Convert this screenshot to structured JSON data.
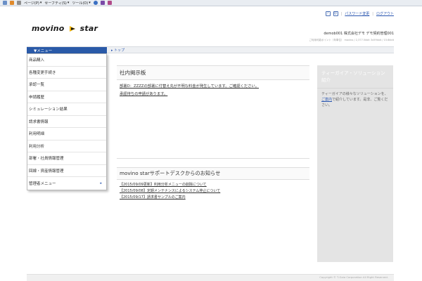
{
  "browser": {
    "toolbar": [
      "ページ(P)",
      "セーフティ(S)",
      "ツール(O)"
    ]
  },
  "header": {
    "help_icon": "?",
    "password_change": "パスワード変更",
    "logout": "ログアウト",
    "logo_left": "movino",
    "logo_right": "star",
    "user_line": "demob001  株式会社デモ  デモ契約管理001",
    "sub_line": "ご利用可能ポイント（年単位） movino / 2,377.5kbit   3x59kbit / 15.6kbit"
  },
  "nav": {
    "menu_label": "▼メニュー",
    "breadcrumb": "▸ トップ"
  },
  "menu": {
    "items": [
      {
        "label": "商品購入",
        "has_sub": false
      },
      {
        "label": "各種変更手続き",
        "has_sub": false
      },
      {
        "label": "承認一覧",
        "has_sub": false
      },
      {
        "label": "申請履歴",
        "has_sub": false
      },
      {
        "label": "シミュレーション結果",
        "has_sub": false
      },
      {
        "label": "請求書情報",
        "has_sub": false
      },
      {
        "label": "利用明細",
        "has_sub": false
      },
      {
        "label": "利用分析",
        "has_sub": false
      },
      {
        "label": "部署・社員情報管理",
        "has_sub": false
      },
      {
        "label": "回線・資産情報管理",
        "has_sub": false
      },
      {
        "label": "管理者メニュー",
        "has_sub": true,
        "arrow": "▸"
      }
    ]
  },
  "bbs": {
    "title": "社内掲示板",
    "lines": [
      "部署D：ZZZZの部署に付替え先が不明な料金が発生しています。ご確認ください。",
      "承認待ちの申請があります。"
    ]
  },
  "support": {
    "title": "movino starサポートデスクからのお知らせ",
    "news": [
      "【2015/09/09更新】利用分析メニューの削除について",
      "【2015/09/08】定期メンテナンスによるシステム停止について",
      "【2015/09/17】請求書サンプルのご案内"
    ]
  },
  "sidebar": {
    "title": "ティーガイア・ソリューション紹介",
    "body_before": "ティーガイアの様々なソリューションを、",
    "link": "ご案内",
    "body_after": "で紹介しています。是非、ご覧ください。"
  },
  "footer": {
    "copyright": "Copyright © T-Gaia Corporation All Right Reserved."
  },
  "colors": {
    "accent": "#2a5aa8",
    "link": "#2a56b0",
    "sidebar_bg": "#e4e4e4"
  }
}
